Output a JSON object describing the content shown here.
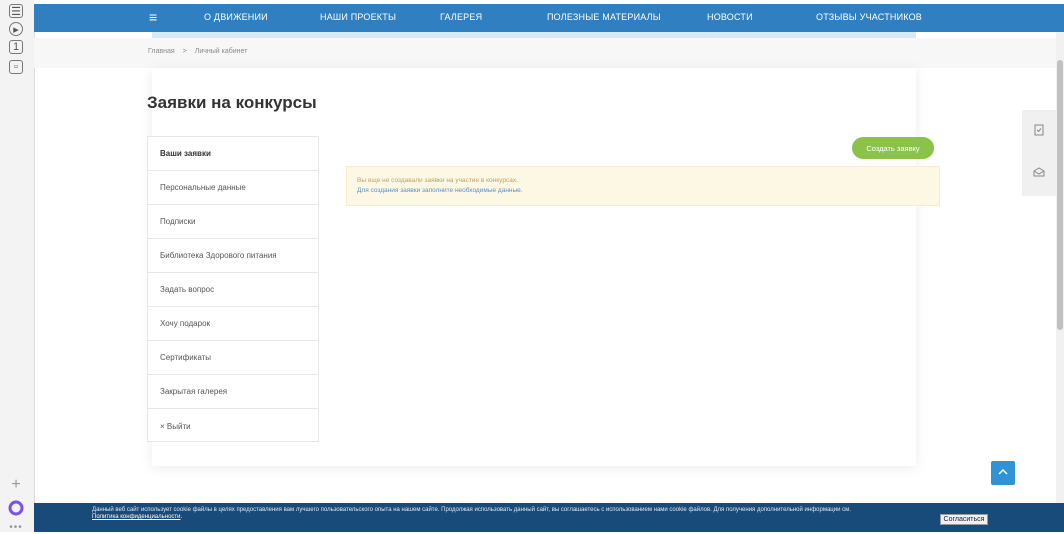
{
  "nav": {
    "items": [
      {
        "label": "О ДВИЖЕНИИ"
      },
      {
        "label": "НАШИ ПРОЕКТЫ"
      },
      {
        "label": "ГАЛЕРЕЯ"
      },
      {
        "label": "ПОЛЕЗНЫЕ МАТЕРИАЛЫ"
      },
      {
        "label": "НОВОСТИ"
      },
      {
        "label": "ОТЗЫВЫ УЧАСТНИКОВ"
      }
    ],
    "menu_icon": "≡"
  },
  "breadcrumb": {
    "home": "Главная",
    "separator": ">",
    "current": "Личный кабинет"
  },
  "page": {
    "title": "Заявки на конкурсы"
  },
  "sidebar": {
    "items": [
      {
        "label": "Ваши заявки"
      },
      {
        "label": "Персональные данные"
      },
      {
        "label": "Подписки"
      },
      {
        "label": "Библиотека Здорового питания"
      },
      {
        "label": "Задать вопрос"
      },
      {
        "label": "Хочу подарок"
      },
      {
        "label": "Сертификаты"
      },
      {
        "label": "Закрытая галерея"
      },
      {
        "label": "× Выйти"
      }
    ]
  },
  "actions": {
    "create_label": "Создать заявку"
  },
  "notice": {
    "line1": "Вы еще не создавали заявки на участие в конкурсах.",
    "line2": "Для создания заявки заполните необходимые данные."
  },
  "cookie": {
    "text": "Данный веб сайт использует cookie файлы в целях предоставления вам лучшего пользовательского опыта на нашем сайте. Продолжая использовать данный сайт, вы соглашаетесь с использованием нами cookie файлов. Для получения дополнительной информации см.",
    "link": "Политика конфиденциальности",
    "accept_label": "Согласиться"
  },
  "colors": {
    "nav_bg": "#2f7fc1",
    "accent_green": "#8bc34a",
    "notice_bg": "#fcf8e3",
    "cookie_bg": "#184a7a"
  },
  "icons": {
    "browser_strip": [
      "notes-icon",
      "play-icon",
      "tab-icon",
      "image-icon",
      "plus-icon",
      "alice-icon",
      "more-icon"
    ],
    "right_panel": [
      "document-check-icon",
      "mail-icon"
    ],
    "scroll_up": "chevron-up-icon"
  }
}
